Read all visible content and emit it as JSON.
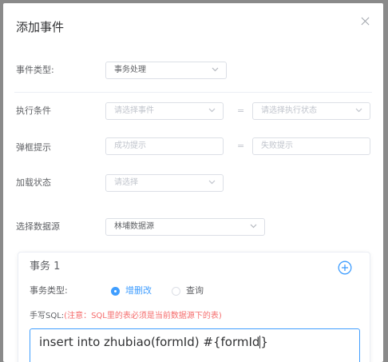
{
  "dialog": {
    "title": "添加事件"
  },
  "form": {
    "event_type": {
      "label": "事件类型:",
      "value": "事务处理"
    },
    "condition": {
      "label": "执行条件",
      "left_placeholder": "请选择事件",
      "separator": "=",
      "right_placeholder": "请选择执行状态"
    },
    "popup": {
      "label": "弹框提示",
      "left_placeholder": "成功提示",
      "separator": "=",
      "right_placeholder": "失败提示"
    },
    "load_state": {
      "label": "加载状态",
      "placeholder": "请选择"
    },
    "datasource": {
      "label": "选择数据源",
      "value": "林埔数据源"
    }
  },
  "transaction": {
    "title": "事务 1",
    "type_label": "事务类型:",
    "options": [
      {
        "label": "增删改",
        "selected": true
      },
      {
        "label": "查询",
        "selected": false
      }
    ],
    "sql_label": "手写SQL:",
    "sql_warning": "(注意：SQL里的表必须是当前数据源下的表)",
    "sql_value": "insert into zhubiao(formId) #{formId"
  },
  "colors": {
    "accent": "#409eff",
    "warning": "#f56c6c"
  },
  "icons": {
    "close": "close-icon",
    "chevron": "chevron-down-icon",
    "add": "plus-circle-icon"
  }
}
